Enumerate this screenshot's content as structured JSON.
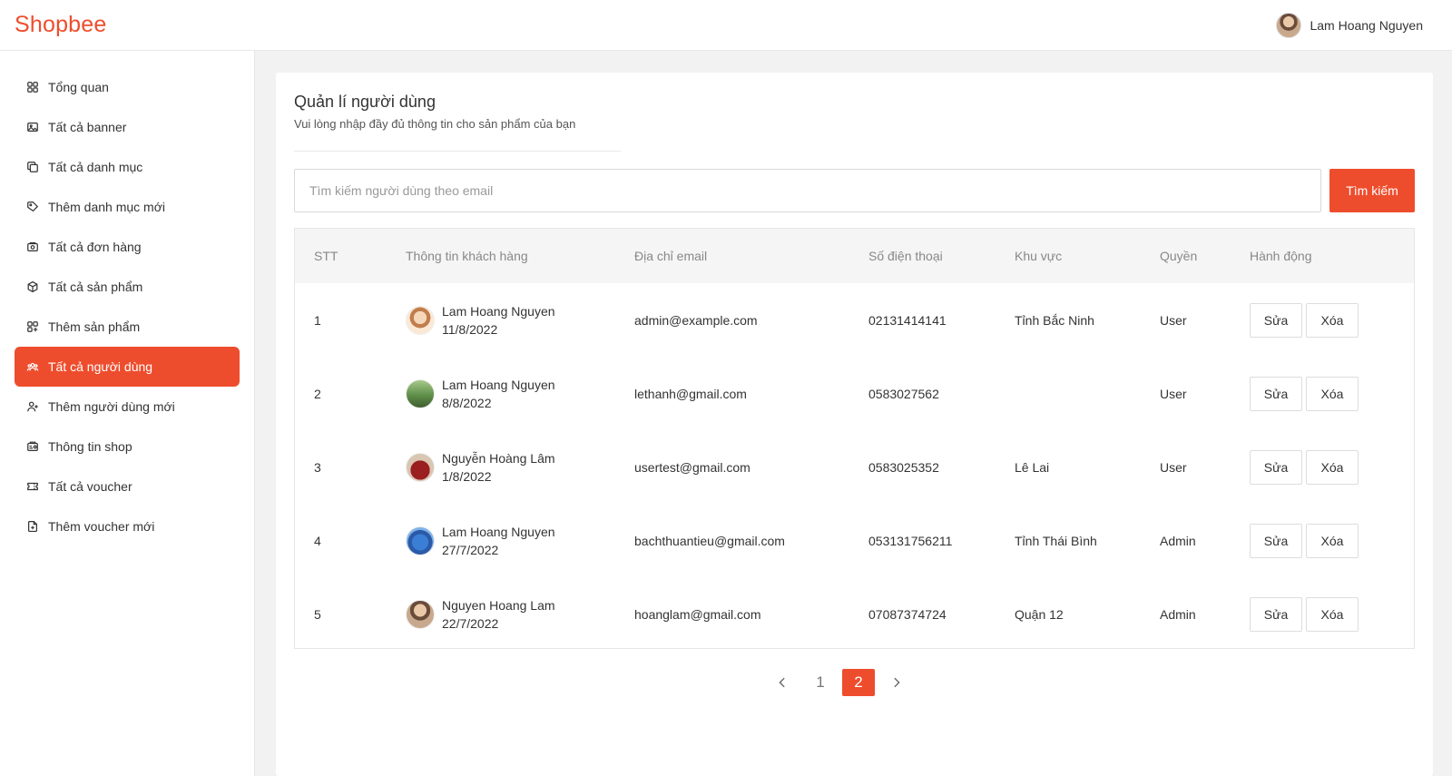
{
  "brand": {
    "name": "Shopbee",
    "accent": "#ee4d2d"
  },
  "header": {
    "user_name": "Lam Hoang Nguyen"
  },
  "sidebar": {
    "items": [
      {
        "label": "Tổng quan",
        "icon": "dashboard-icon",
        "active": false
      },
      {
        "label": "Tất cả banner",
        "icon": "image-icon",
        "active": false
      },
      {
        "label": "Tất cả danh mục",
        "icon": "copy-icon",
        "active": false
      },
      {
        "label": "Thêm danh mục mới",
        "icon": "tag-icon",
        "active": false
      },
      {
        "label": "Tất cả đơn hàng",
        "icon": "orders-icon",
        "active": false
      },
      {
        "label": "Tất cả sản phẩm",
        "icon": "box-icon",
        "active": false
      },
      {
        "label": "Thêm sản phẩm",
        "icon": "grid-add-icon",
        "active": false
      },
      {
        "label": "Tất cả người dùng",
        "icon": "users-icon",
        "active": true
      },
      {
        "label": "Thêm người dùng mới",
        "icon": "user-plus-icon",
        "active": false
      },
      {
        "label": "Thông tin shop",
        "icon": "store-icon",
        "active": false
      },
      {
        "label": "Tất cả voucher",
        "icon": "ticket-icon",
        "active": false
      },
      {
        "label": "Thêm voucher mới",
        "icon": "file-plus-icon",
        "active": false
      }
    ]
  },
  "main": {
    "title": "Quản lí người dùng",
    "subtitle": "Vui lòng nhập đầy đủ thông tin cho sản phẩm của bạn",
    "search": {
      "placeholder": "Tìm kiếm người dùng theo email",
      "value": "",
      "button_label": "Tìm kiếm"
    },
    "table": {
      "columns": [
        "STT",
        "Thông tin khách hàng",
        "Địa chỉ email",
        "Số điện thoại",
        "Khu vực",
        "Quyền",
        "Hành động"
      ],
      "rows": [
        {
          "stt": "1",
          "name": "Lam Hoang Nguyen",
          "date": "11/8/2022",
          "email": "admin@example.com",
          "phone": "02131414141",
          "region": "Tỉnh Bắc Ninh",
          "role": "User"
        },
        {
          "stt": "2",
          "name": "Lam Hoang Nguyen",
          "date": "8/8/2022",
          "email": "lethanh@gmail.com",
          "phone": "0583027562",
          "region": "",
          "role": "User"
        },
        {
          "stt": "3",
          "name": "Nguyễn Hoàng Lâm",
          "date": "1/8/2022",
          "email": "usertest@gmail.com",
          "phone": "0583025352",
          "region": "Lê Lai",
          "role": "User"
        },
        {
          "stt": "4",
          "name": "Lam Hoang Nguyen",
          "date": "27/7/2022",
          "email": "bachthuantieu@gmail.com",
          "phone": "053131756211",
          "region": "Tỉnh Thái Bình",
          "role": "Admin"
        },
        {
          "stt": "5",
          "name": "Nguyen Hoang Lam",
          "date": "22/7/2022",
          "email": "hoanglam@gmail.com",
          "phone": "07087374724",
          "region": "Quận 12",
          "role": "Admin"
        }
      ],
      "edit_label": "Sửa",
      "delete_label": "Xóa"
    },
    "pagination": {
      "pages": [
        "1",
        "2"
      ],
      "current": "2"
    }
  }
}
